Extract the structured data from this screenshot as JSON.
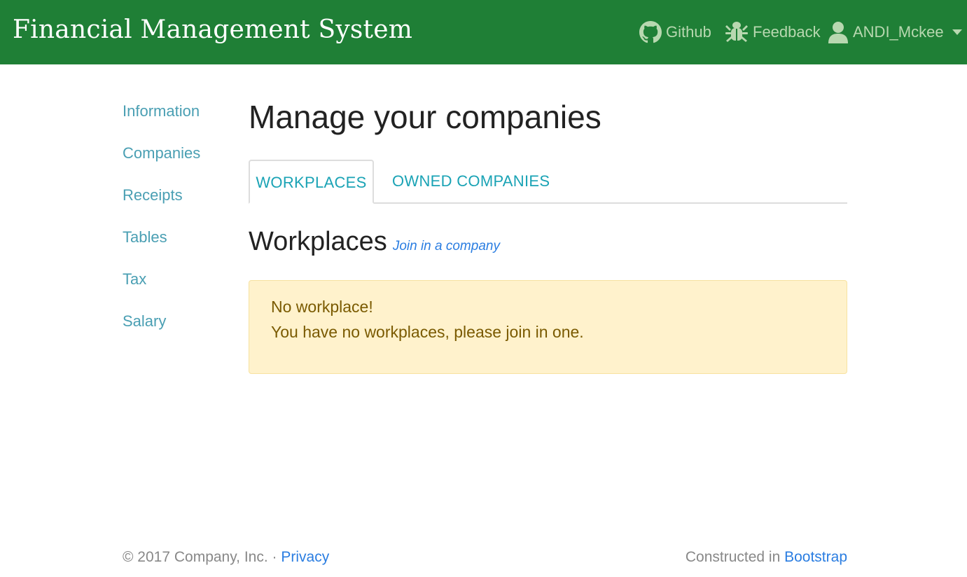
{
  "navbar": {
    "brand": "Financial Management System",
    "github_label": "Github",
    "feedback_label": "Feedback",
    "user_label": "ANDI_Mckee",
    "colors": {
      "background": "#1f7f36",
      "text": "#b8d8b0"
    },
    "icons": [
      "github-icon",
      "bug-icon",
      "user-icon",
      "caret-down-icon"
    ]
  },
  "sidebar": {
    "items": [
      {
        "label": "Information"
      },
      {
        "label": "Companies"
      },
      {
        "label": "Receipts"
      },
      {
        "label": "Tables"
      },
      {
        "label": "Tax"
      },
      {
        "label": "Salary"
      }
    ]
  },
  "main": {
    "title": "Manage your companies",
    "tabs": [
      {
        "label": "WORKPLACES",
        "active": true
      },
      {
        "label": "OWNED COMPANIES",
        "active": false
      }
    ],
    "section": {
      "title": "Workplaces",
      "link": "Join in a company"
    },
    "alert": {
      "title": "No workplace!",
      "body": "You have no workplaces, please join in one.",
      "colors": {
        "background": "#fff2cc",
        "text": "#7a5a00"
      }
    }
  },
  "footer": {
    "copyright": "© 2017 Company, Inc. · ",
    "privacy": "Privacy",
    "constructed": "Constructed in ",
    "bootstrap": "Bootstrap"
  }
}
